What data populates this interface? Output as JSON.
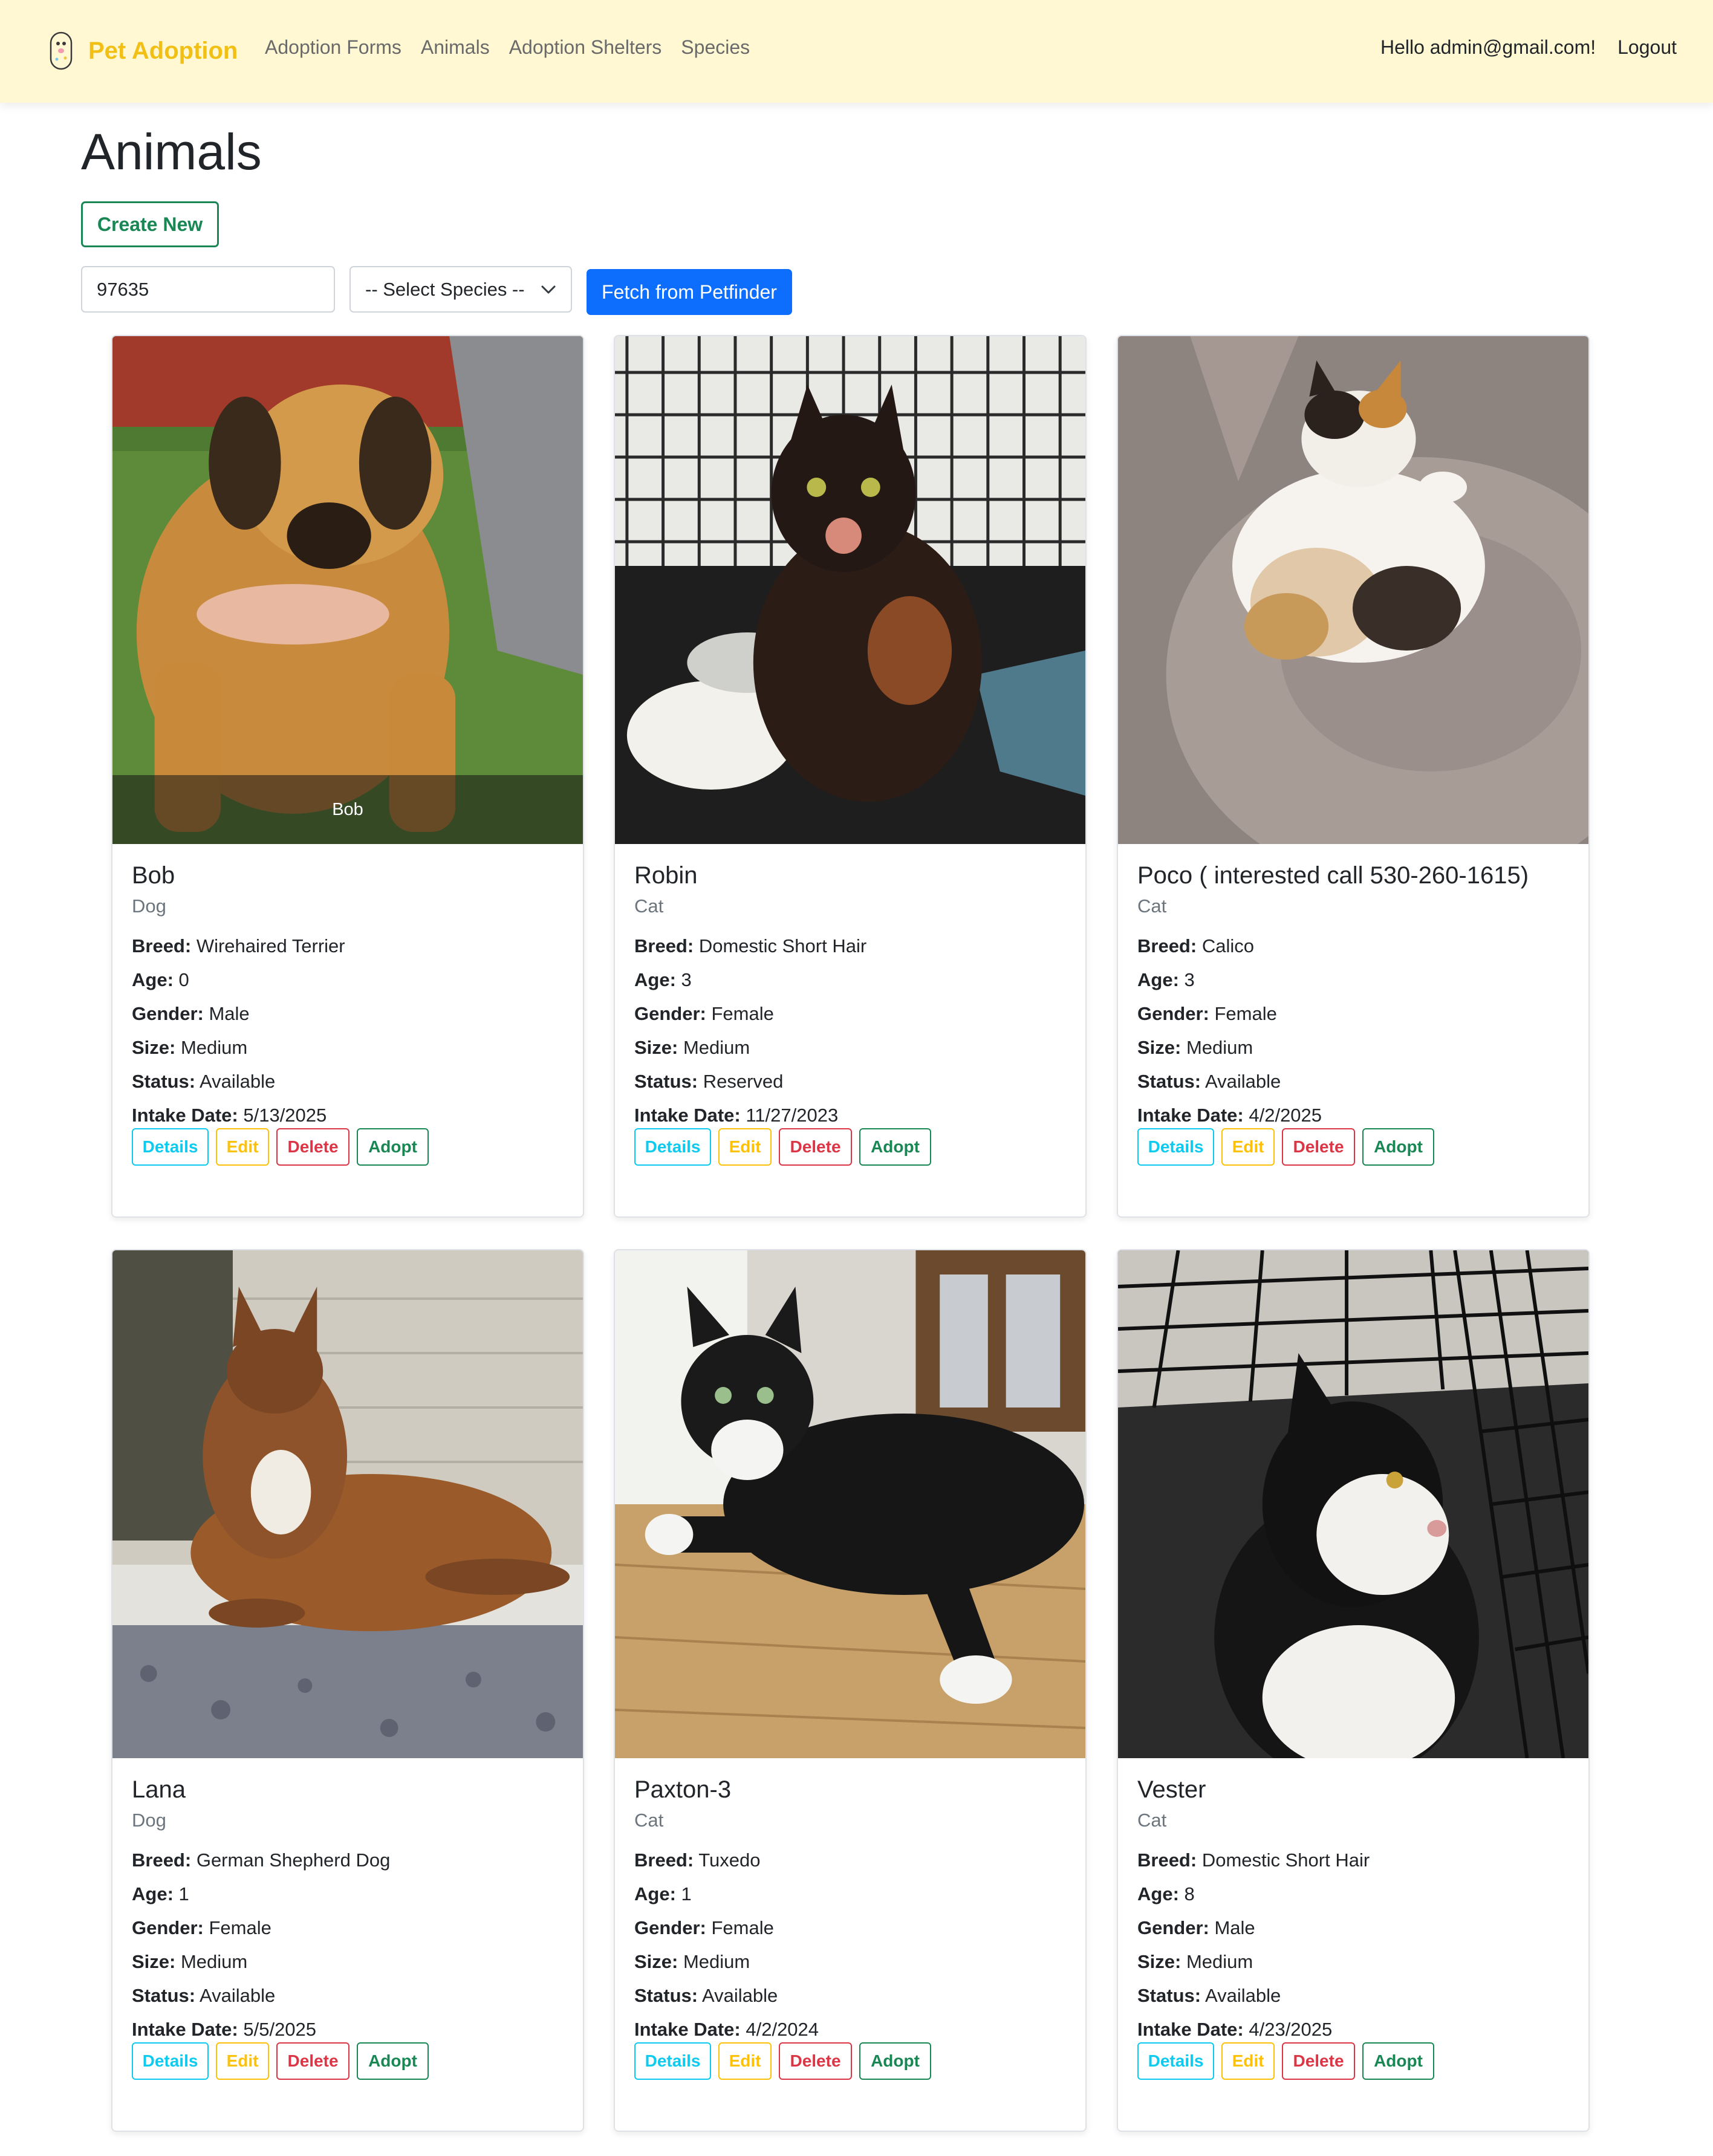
{
  "nav": {
    "brand": "Pet Adoption",
    "links": [
      "Adoption Forms",
      "Animals",
      "Adoption Shelters",
      "Species"
    ],
    "greeting": "Hello admin@gmail.com!",
    "logout": "Logout"
  },
  "page": {
    "title": "Animals",
    "create_label": "Create New",
    "zip_value": "97635",
    "species_select": "-- Select Species --",
    "fetch_label": "Fetch from Petfinder"
  },
  "labels": {
    "breed": "Breed:",
    "age": "Age:",
    "gender": "Gender:",
    "size": "Size:",
    "status": "Status:",
    "intake": "Intake Date:"
  },
  "actions": {
    "details": "Details",
    "edit": "Edit",
    "delete": "Delete",
    "adopt": "Adopt"
  },
  "animals": [
    {
      "name": "Bob",
      "species": "Dog",
      "breed": "Wirehaired Terrier",
      "age": "0",
      "gender": "Male",
      "size": "Medium",
      "status": "Available",
      "intake": "5/13/2025",
      "photo_caption": "Bob",
      "photo": "puppy-photo"
    },
    {
      "name": "Robin",
      "species": "Cat",
      "breed": "Domestic Short Hair",
      "age": "3",
      "gender": "Female",
      "size": "Medium",
      "status": "Reserved",
      "intake": "11/27/2023",
      "photo": "tortoiseshell-cat-photo"
    },
    {
      "name": "Poco ( interested call 530-260-1615)",
      "species": "Cat",
      "breed": "Calico",
      "age": "3",
      "gender": "Female",
      "size": "Medium",
      "status": "Available",
      "intake": "4/2/2025",
      "photo": "calico-cat-photo"
    },
    {
      "name": "Lana",
      "species": "Dog",
      "breed": "German Shepherd Dog",
      "age": "1",
      "gender": "Female",
      "size": "Medium",
      "status": "Available",
      "intake": "5/5/2025",
      "photo": "shepherd-dog-photo"
    },
    {
      "name": "Paxton-3",
      "species": "Cat",
      "breed": "Tuxedo",
      "age": "1",
      "gender": "Female",
      "size": "Medium",
      "status": "Available",
      "intake": "4/2/2024",
      "photo": "tuxedo-cat-photo"
    },
    {
      "name": "Vester",
      "species": "Cat",
      "breed": "Domestic Short Hair",
      "age": "8",
      "gender": "Male",
      "size": "Medium",
      "status": "Available",
      "intake": "4/23/2025",
      "photo": "black-white-cat-photo"
    }
  ],
  "colors": {
    "navbar_bg": "#fff8d3",
    "brand": "#f2c014",
    "success": "#198754",
    "primary": "#0d6efd",
    "info": "#0dcaf0",
    "warning": "#ffc107",
    "danger": "#dc3545"
  }
}
